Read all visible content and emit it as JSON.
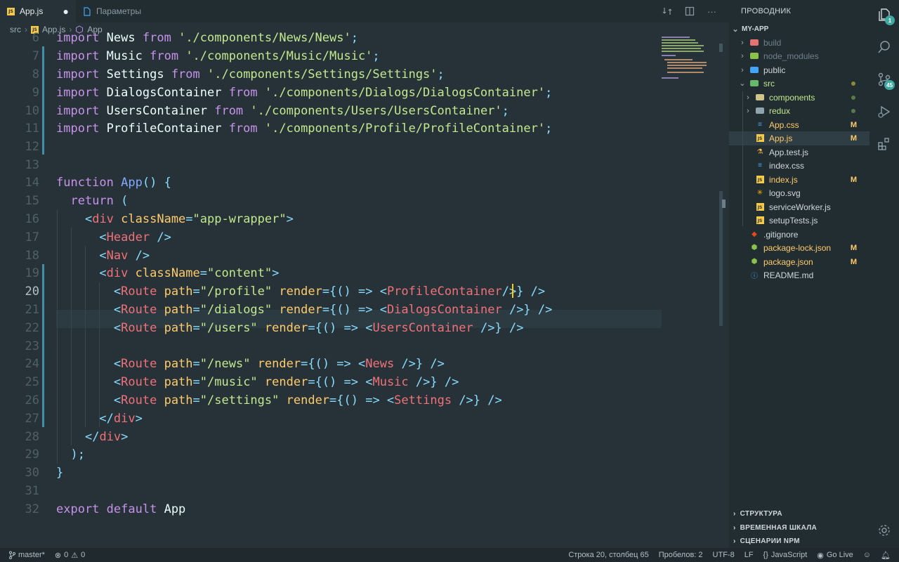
{
  "tabs": [
    {
      "label": "App.js",
      "active": true,
      "modified": true,
      "icon": "js-icon"
    },
    {
      "label": "Параметры",
      "active": false,
      "icon": "settings-file-icon"
    }
  ],
  "tab_dirty_mark": "●",
  "breadcrumb": {
    "folder": "src",
    "file": "App.js",
    "symbol": "App"
  },
  "editor": {
    "current_line": 20,
    "lines": [
      {
        "n": "6"
      },
      {
        "n": "7"
      },
      {
        "n": "8"
      },
      {
        "n": "9"
      },
      {
        "n": "10"
      },
      {
        "n": "11"
      },
      {
        "n": "12"
      },
      {
        "n": "13"
      },
      {
        "n": "14"
      },
      {
        "n": "15"
      },
      {
        "n": "16"
      },
      {
        "n": "17"
      },
      {
        "n": "18"
      },
      {
        "n": "19"
      },
      {
        "n": "20"
      },
      {
        "n": "21"
      },
      {
        "n": "22"
      },
      {
        "n": "23"
      },
      {
        "n": "24"
      },
      {
        "n": "25"
      },
      {
        "n": "26"
      },
      {
        "n": "27"
      },
      {
        "n": "28"
      },
      {
        "n": "29"
      },
      {
        "n": "30"
      },
      {
        "n": "31"
      },
      {
        "n": "32"
      }
    ],
    "tokens": {
      "import": "import",
      "from": "from",
      "function": "function",
      "return": "return",
      "export": "export",
      "default": "default",
      "News": "News",
      "Music": "Music",
      "Settings": "Settings",
      "DialogsContainer": "DialogsContainer",
      "UsersContainer": "UsersContainer",
      "ProfileContainer": "ProfileContainer",
      "App": "App",
      "path_news": "'./components/News/News'",
      "path_music": "'./components/Music/Music'",
      "path_settings": "'./components/Settings/Settings'",
      "path_dialogs": "'./components/Dialogs/DialogsContainer'",
      "path_users": "'./components/Users/UsersContainer'",
      "path_profile": "'./components/Profile/ProfileContainer'",
      "div": "div",
      "className": "className",
      "app_wrapper": "\"app-wrapper\"",
      "content": "\"content\"",
      "Header": "Header",
      "Nav": "Nav",
      "Route": "Route",
      "path_attr": "path",
      "render": "render",
      "r_profile": "\"/profile\"",
      "r_dialogs": "\"/dialogs\"",
      "r_users": "\"/users\"",
      "r_news": "\"/news\"",
      "r_music": "\"/music\"",
      "r_settings": "\"/settings\""
    }
  },
  "explorer": {
    "title": "ПРОВОДНИК",
    "root": "MY-APP",
    "items": [
      {
        "label": "build",
        "type": "folder",
        "dim": true
      },
      {
        "label": "node_modules",
        "type": "folder",
        "dim": true
      },
      {
        "label": "public",
        "type": "folder"
      },
      {
        "label": "src",
        "type": "folder",
        "open": true
      },
      {
        "label": "components",
        "type": "folder"
      },
      {
        "label": "redux",
        "type": "folder"
      },
      {
        "label": "App.css",
        "type": "css",
        "badge": "M"
      },
      {
        "label": "App.js",
        "type": "js",
        "badge": "M",
        "selected": true
      },
      {
        "label": "App.test.js",
        "type": "test"
      },
      {
        "label": "index.css",
        "type": "css"
      },
      {
        "label": "index.js",
        "type": "js",
        "badge": "M"
      },
      {
        "label": "logo.svg",
        "type": "svg"
      },
      {
        "label": "serviceWorker.js",
        "type": "js"
      },
      {
        "label": "setupTests.js",
        "type": "js"
      },
      {
        "label": ".gitignore",
        "type": "git"
      },
      {
        "label": "package-lock.json",
        "type": "json",
        "badge": "M"
      },
      {
        "label": "package.json",
        "type": "json",
        "badge": "M"
      },
      {
        "label": "README.md",
        "type": "md"
      }
    ],
    "panels": [
      "СТРУКТУРА",
      "ВРЕМЕННАЯ ШКАЛА",
      "СЦЕНАРИИ NPM"
    ]
  },
  "activity": {
    "explorer_badge": "1",
    "scm_badge": "45"
  },
  "status": {
    "branch": "master*",
    "errors": "0",
    "warnings": "0",
    "position": "Строка 20, столбец 65",
    "spaces": "Пробелов: 2",
    "encoding": "UTF-8",
    "eol": "LF",
    "language": "JavaScript",
    "golive": "Go Live"
  },
  "colors": {
    "background": "#263238",
    "keyword": "#c792ea",
    "string": "#c3e88d",
    "function": "#82aaff",
    "tag": "#f07178",
    "attribute": "#ffcb6b",
    "punctuation": "#89ddff"
  }
}
